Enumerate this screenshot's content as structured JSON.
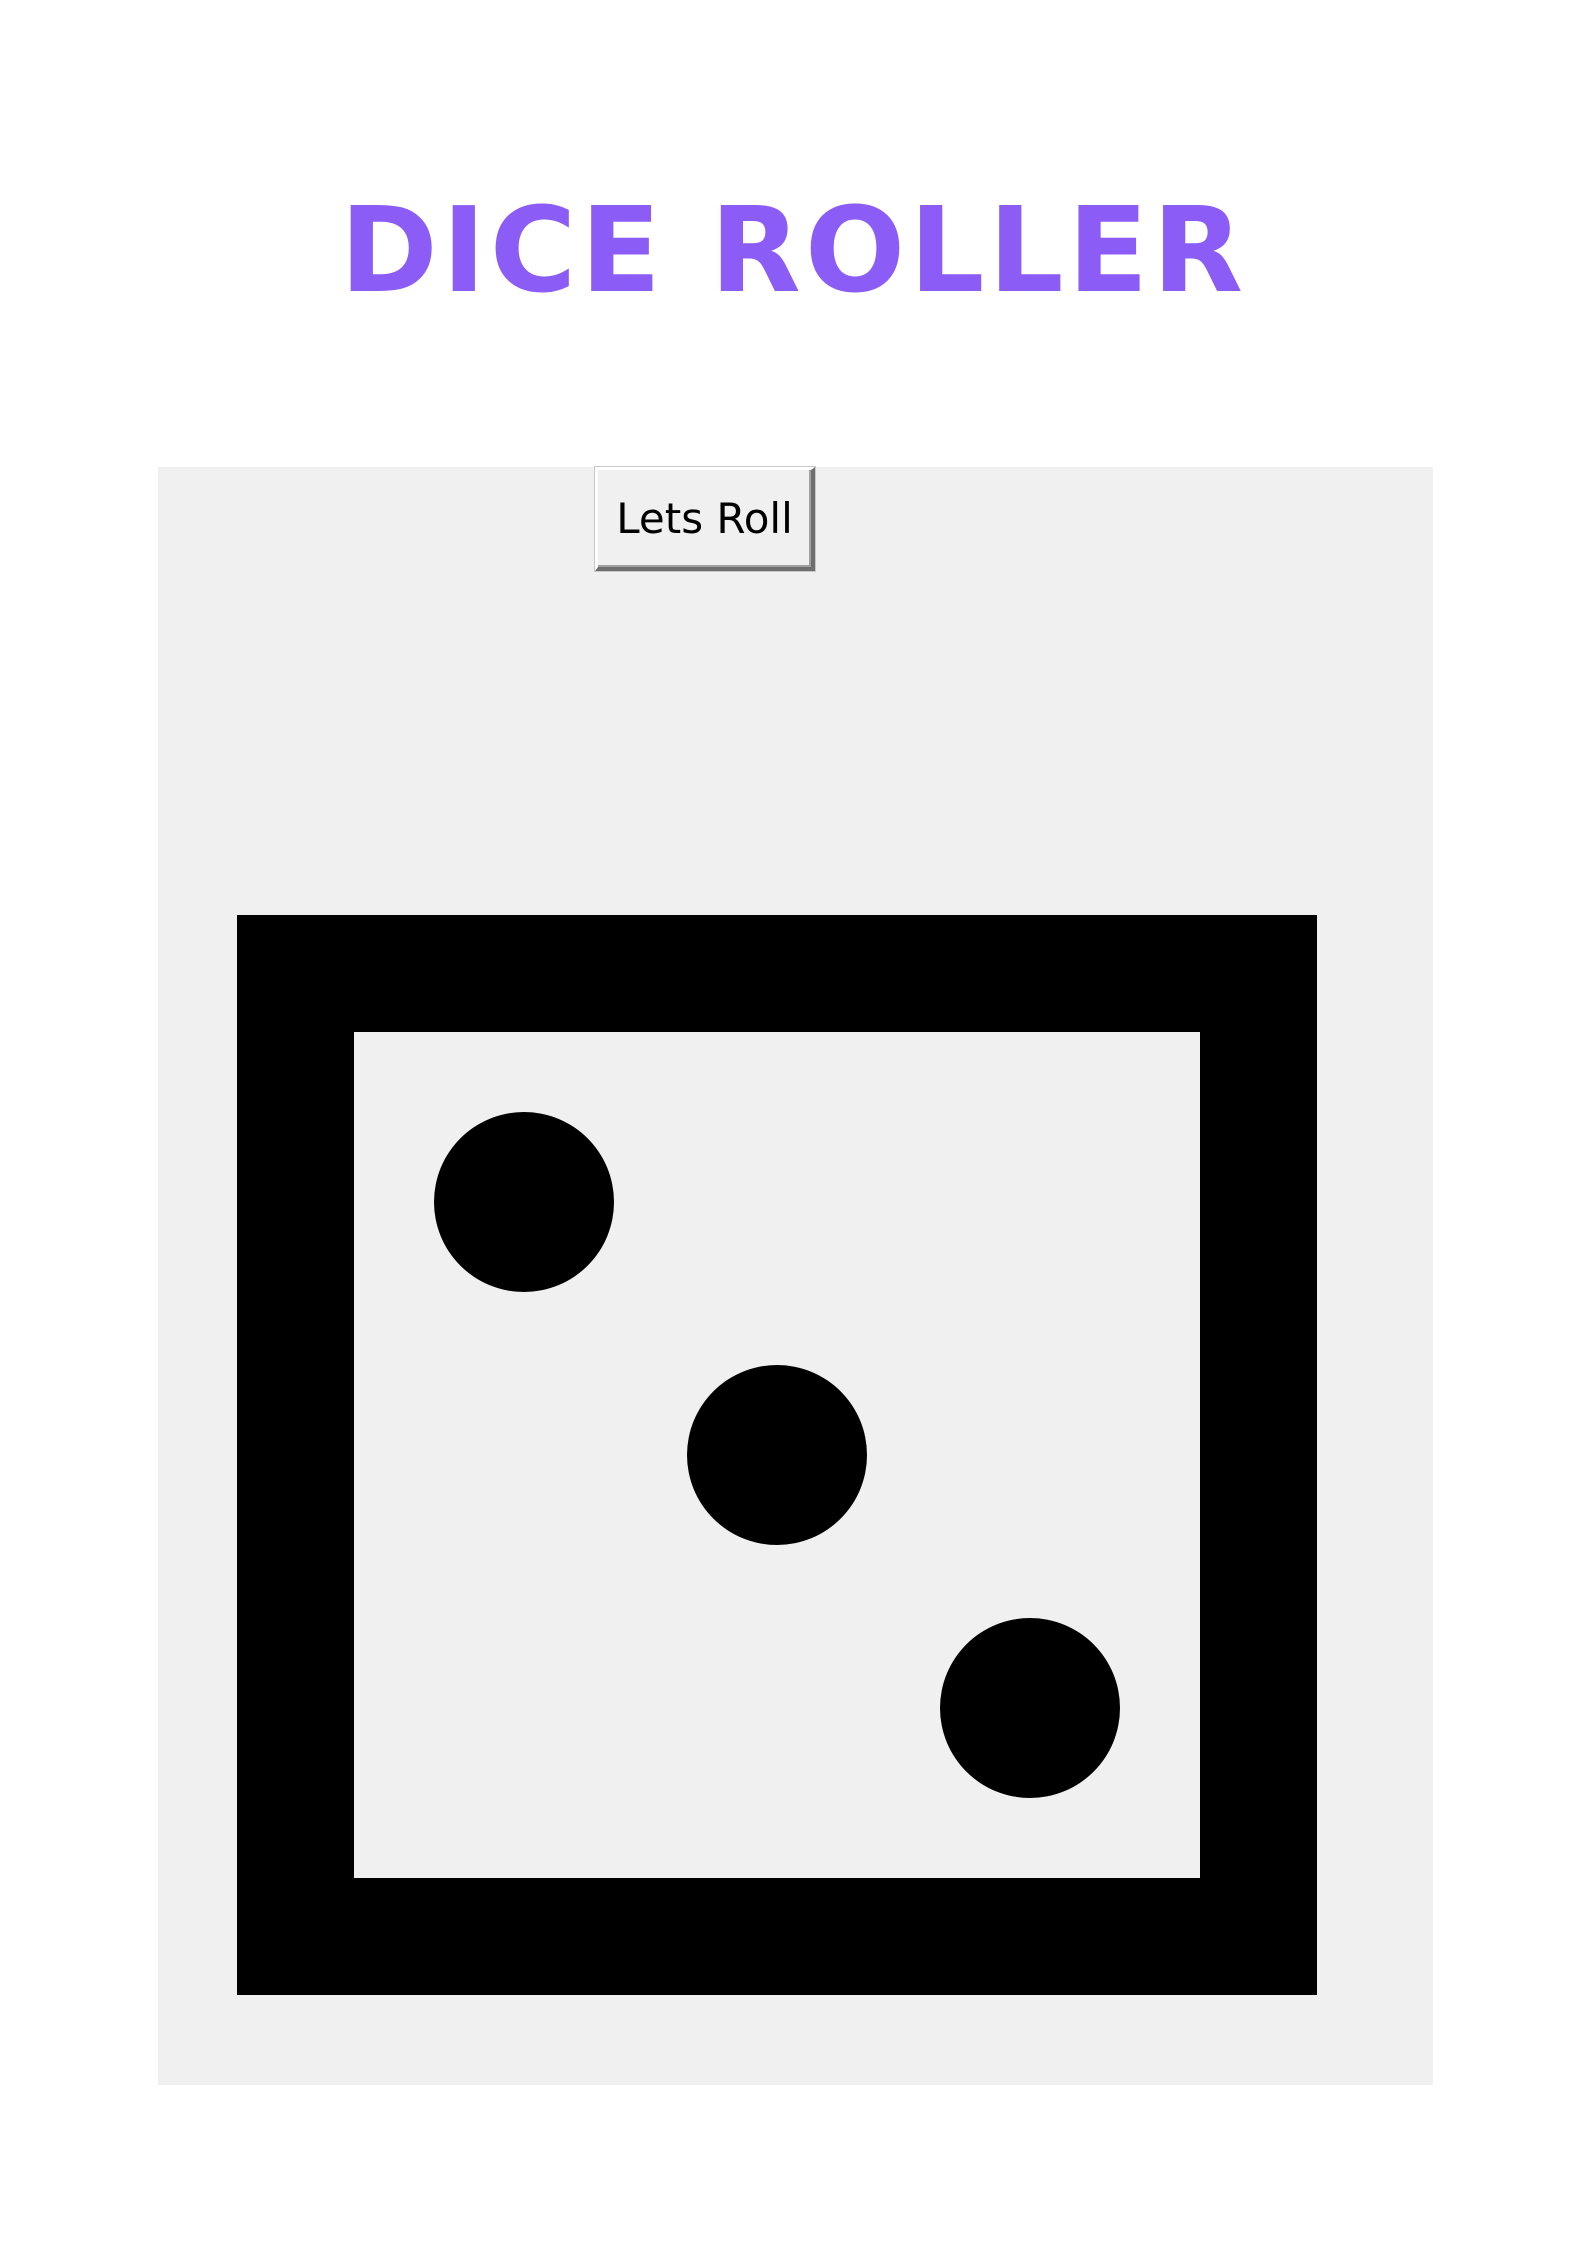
{
  "page": {
    "title": "DICE ROLLER",
    "title_color": "#8b5cf6"
  },
  "app": {
    "background_color": "#f0f0f0",
    "roll_button_label": "Lets Roll",
    "die": {
      "value": 3,
      "border_color": "#000000",
      "pip_color": "#000000",
      "face_color": "#f0f0f0"
    }
  }
}
